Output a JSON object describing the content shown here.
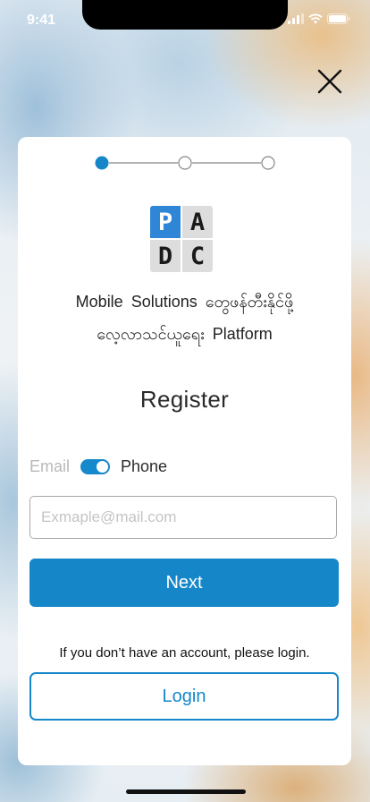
{
  "status_bar": {
    "time": "9:41"
  },
  "stepper": {
    "current_step": 1,
    "total_steps": 3
  },
  "logo": {
    "letters": [
      "P",
      "A",
      "D",
      "C"
    ]
  },
  "tagline": {
    "line1": "Mobile  Solutions  တွေဖန်တီးနိုင်ဖို့",
    "line2": "လေ့လာသင်ယူရေး  Platform"
  },
  "form": {
    "title": "Register",
    "toggle": {
      "left_label": "Email",
      "right_label": "Phone",
      "selected": "Phone"
    },
    "input_placeholder": "Exmaple@mail.com",
    "input_value": "",
    "next_label": "Next"
  },
  "footer": {
    "hint": "If you don’t have an account, please login.",
    "login_label": "Login"
  },
  "colors": {
    "accent": "#1587c9",
    "logo_blue": "#2f86d6"
  }
}
